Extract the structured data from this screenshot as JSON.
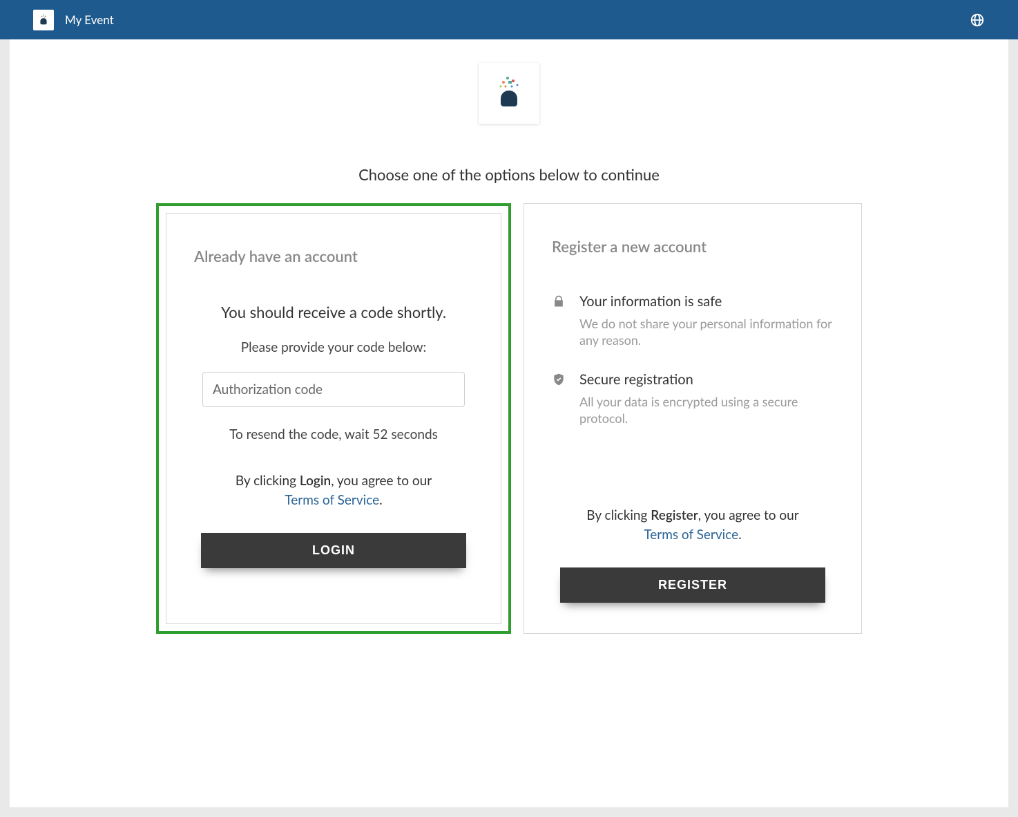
{
  "header": {
    "title": "My Event"
  },
  "main": {
    "instruction": "Choose one of the options below to continue",
    "login": {
      "panel_title": "Already have an account",
      "headline": "You should receive a code shortly.",
      "subhead": "Please provide your code below:",
      "code_placeholder": "Authorization code",
      "resend_text": "To resend the code, wait 52 seconds",
      "consent_prefix": "By clicking ",
      "consent_action": "Login",
      "consent_suffix": ", you agree to our ",
      "tos_label": "Terms of Service",
      "button_label": "LOGIN"
    },
    "register": {
      "panel_title": "Register a new account",
      "feature1_title": "Your information is safe",
      "feature1_desc": "We do not share your personal information for any reason.",
      "feature2_title": "Secure registration",
      "feature2_desc": "All your data is encrypted using a secure protocol.",
      "consent_prefix": "By clicking ",
      "consent_action": "Register",
      "consent_suffix": ", you agree to our ",
      "tos_label": "Terms of Service",
      "button_label": "REGISTER"
    }
  }
}
